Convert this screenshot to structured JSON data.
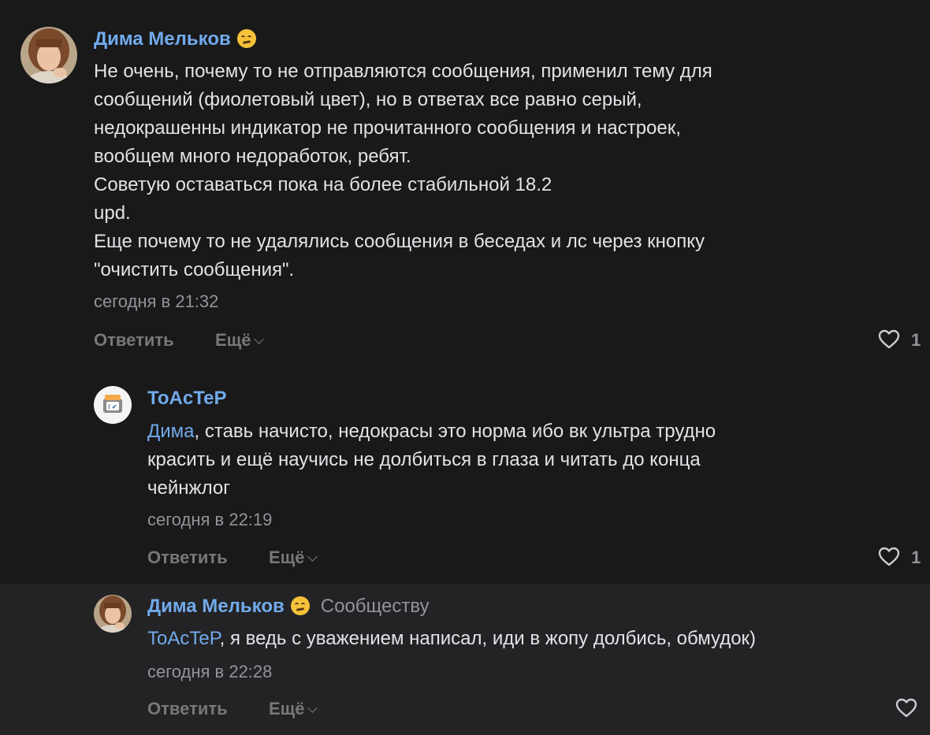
{
  "comments": [
    {
      "author": "Дима Мельков",
      "text": "Не очень, почему то не отправляются сообщения, применил тему для\nсообщений (фиолетовый цвет), но в ответах все равно серый,\nнедокрашенны индикатор не прочитанного сообщения и настроек,\nвообщем много недоработок, ребят.\nСоветую оставаться пока на более стабильной 18.2\nupd.\nЕще почему то не удалялись сообщения в беседах и лс через кнопку\n\"очистить сообщения\".",
      "time": "сегодня в 21:32",
      "reply_label": "Ответить",
      "more_label": "Ещё",
      "likes": "1"
    },
    {
      "author": "ToAcTeP",
      "mention": "Дима",
      "text": ", ставь начисто, недокрасы это норма ибо вк ультра трудно\nкрасить и ещё научись не долбиться в глаза и читать до конца\nчейнжлог",
      "time": "сегодня в 22:19",
      "reply_label": "Ответить",
      "more_label": "Ещё",
      "likes": "1"
    },
    {
      "author": "Дима Мельков",
      "badge": "Сообществу",
      "mention": "ToAcTeP",
      "text": ", я ведь с уважением написал, иди в жопу долбись, обмудок)",
      "time": "сегодня в 22:28",
      "reply_label": "Ответить",
      "more_label": "Ещё",
      "likes": ""
    }
  ],
  "colors": {
    "background": "#19191a",
    "highlight": "#232325",
    "accent": "#71aaeb",
    "text": "#e1e3e6",
    "secondary": "#909499"
  }
}
